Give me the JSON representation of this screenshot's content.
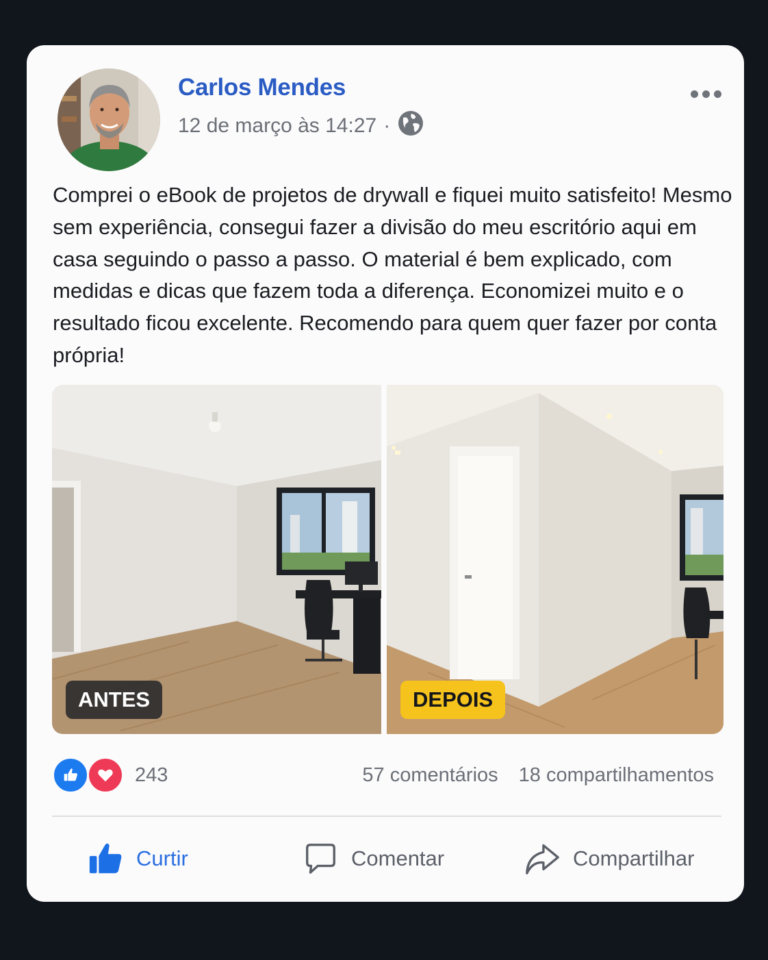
{
  "post": {
    "author": "Carlos Mendes",
    "timestamp": "12 de março às 14:27",
    "separator": "·",
    "privacy_icon": "globe-icon",
    "text": "Comprei o eBook de projetos de drywall e fiquei muito satisfeito! Mesmo sem experiência, consegui fazer a divisão do meu escritório aqui em casa seguindo o passo a passo. O material é bem explicado, com medidas e dicas que fazem toda a diferença. Economizei muito e o resultado ficou excelente. Recomendo para quem quer fazer por conta própria!",
    "images": [
      {
        "tag": "ANTES"
      },
      {
        "tag": "DEPOIS"
      }
    ]
  },
  "reactions": {
    "icons": [
      "like-icon",
      "love-icon"
    ],
    "count": "243",
    "comments": "57 comentários",
    "shares": "18 compartilhamentos"
  },
  "actions": {
    "like": "Curtir",
    "comment": "Comentar",
    "share": "Compartilhar"
  },
  "colors": {
    "background": "#11161c",
    "card": "#fbfbfc",
    "author": "#2a5cc4",
    "like": "#1d7bf0",
    "love": "#ee3a56",
    "tag_after": "#f6c31d"
  }
}
